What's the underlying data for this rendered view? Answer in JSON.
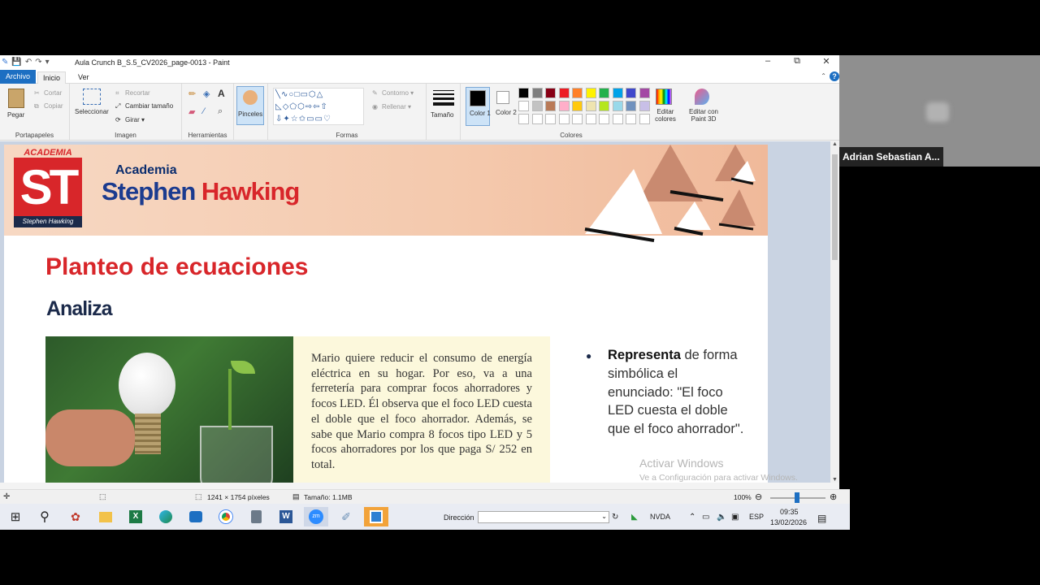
{
  "window": {
    "title": "Aula Crunch B_S.5_CV2026_page-0013 - Paint",
    "controls": [
      "–",
      "⧉",
      "✕"
    ]
  },
  "tabs": {
    "file": "Archivo",
    "home": "Inicio",
    "view": "Ver"
  },
  "help_icon": "?",
  "ribbon": {
    "clipboard": {
      "paste": "Pegar",
      "cut": "Cortar",
      "copy": "Copiar",
      "label": "Portapapeles"
    },
    "image": {
      "select": "Seleccionar",
      "crop": "Recortar",
      "resize": "Cambiar tamaño",
      "rotate": "Girar",
      "label": "Imagen"
    },
    "tools": {
      "label": "Herramientas"
    },
    "brushes": {
      "label": "Pinceles"
    },
    "shapes": {
      "outline": "Contorno",
      "fill": "Rellenar",
      "label": "Formas"
    },
    "size": {
      "label": "Tamaño"
    },
    "colors": {
      "color1": "Color 1",
      "color1_line2": "1",
      "color2": "Color 2",
      "color2_line2": "2",
      "edit": "Editar colores",
      "label": "Colores",
      "paint3d": "Editar con Paint 3D",
      "palette_row1": [
        "#000000",
        "#7f7f7f",
        "#880015",
        "#ed1c24",
        "#ff7f27",
        "#fff200",
        "#22b14c",
        "#00a2e8",
        "#3f48cc",
        "#a349a4"
      ],
      "palette_row2": [
        "#ffffff",
        "#c3c3c3",
        "#b97a57",
        "#ffaec9",
        "#ffc90e",
        "#efe4b0",
        "#b5e61d",
        "#99d9ea",
        "#7092be",
        "#c8bfe7"
      ]
    }
  },
  "document": {
    "logo_text_top": "ACADEMIA",
    "logo_letters": "ST",
    "logo_text_bottom": "Stephen Hawking",
    "brand_small": "Academia",
    "brand_big_1": "Stephen ",
    "brand_big_2": "Hawking",
    "title": "Planteo de ecuaciones",
    "subtitle": "Analiza",
    "problem": "Mario quiere reducir el consumo de energía eléctrica en su hogar. Por eso, va a una ferretería para comprar focos ahorradores y focos LED. Él observa que el foco LED cuesta el doble que el foco ahorrador. Además, se sabe que Mario compra 8 focos tipo LED y 5 focos ahorradores por los que paga S/ 252 en total.",
    "represent_bold": "Representa",
    "represent_rest": " de forma simbólica el enunciado: \"El foco LED cuesta el doble que el foco ahorrador\"."
  },
  "activate": {
    "title": "Activar Windows",
    "sub": "Ve a Configuración para activar Windows."
  },
  "status": {
    "dimensions": "1241 × 1754 píxeles",
    "size": "Tamaño: 1.1MB",
    "zoom": "100%"
  },
  "taskbar": {
    "address_label": "Dirección",
    "nvda": "NVDA",
    "lang": "ESP",
    "time": "09:35",
    "date": "13/02/2026"
  },
  "participant": {
    "name": "Adrian Sebastian A..."
  }
}
